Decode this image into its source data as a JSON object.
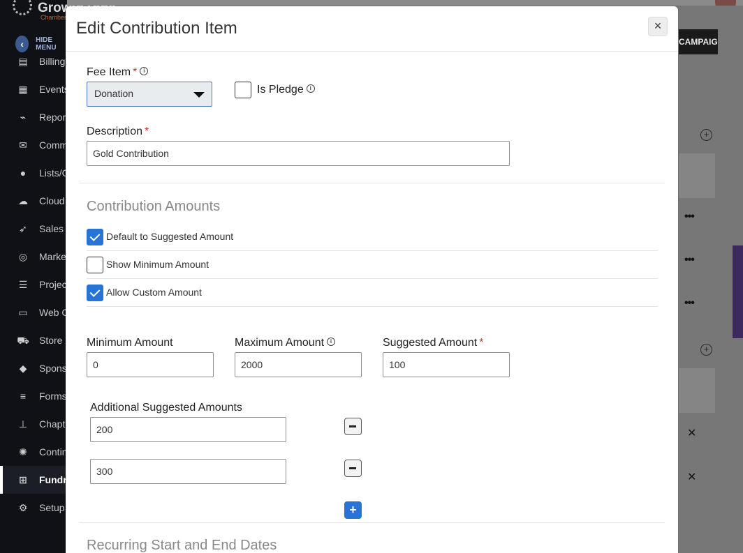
{
  "app": {
    "logo_text": "GrowthZone",
    "logo_sub": "Chamber",
    "hide_menu_label": "HIDE MENU",
    "nav_items": [
      {
        "label": "Billing",
        "icon": "billing-icon"
      },
      {
        "label": "Events",
        "icon": "calendar-icon"
      },
      {
        "label": "Reports",
        "icon": "chart-icon"
      },
      {
        "label": "Communication",
        "icon": "envelope-icon"
      },
      {
        "label": "Lists/Groups",
        "icon": "users-icon"
      },
      {
        "label": "Cloud",
        "icon": "cloud-icon"
      },
      {
        "label": "Sales",
        "icon": "rocket-icon"
      },
      {
        "label": "Marketing",
        "icon": "target-icon"
      },
      {
        "label": "Projects",
        "icon": "checklist-icon"
      },
      {
        "label": "Web Content",
        "icon": "web-icon"
      },
      {
        "label": "Store",
        "icon": "cart-icon"
      },
      {
        "label": "Sponsorships",
        "icon": "diamond-icon"
      },
      {
        "label": "Forms",
        "icon": "list-icon"
      },
      {
        "label": "Chapters",
        "icon": "sitemap-icon"
      },
      {
        "label": "Continuing Ed",
        "icon": "badge-icon"
      },
      {
        "label": "Fundraising",
        "icon": "gift-icon",
        "active": true
      },
      {
        "label": "Setup",
        "icon": "gear-icon"
      }
    ],
    "campaign_button": "CAMPAIGN"
  },
  "modal": {
    "title": "Edit Contribution Item",
    "close_glyph": "×",
    "fee_item": {
      "label": "Fee Item",
      "required_mark": "*",
      "selected": "Donation"
    },
    "is_pledge": {
      "label": "Is Pledge",
      "checked": false
    },
    "description": {
      "label": "Description",
      "required_mark": "*",
      "value": "Gold Contribution"
    },
    "contribution_amounts": {
      "title": "Contribution Amounts",
      "options": [
        {
          "label": "Default to Suggested Amount",
          "checked": true
        },
        {
          "label": "Show Minimum Amount",
          "checked": false
        },
        {
          "label": "Allow Custom Amount",
          "checked": true
        }
      ]
    },
    "amounts": {
      "minimum": {
        "label": "Minimum Amount",
        "value": "0"
      },
      "maximum": {
        "label": "Maximum Amount",
        "value": "2000"
      },
      "suggested": {
        "label": "Suggested Amount",
        "required_mark": "*",
        "value": "100"
      }
    },
    "additional": {
      "label": "Additional Suggested Amounts",
      "values": [
        "200",
        "300"
      ],
      "add_glyph": "+"
    },
    "recurring": {
      "title": "Recurring Start and End Dates"
    }
  },
  "colors": {
    "primary": "#2873d6",
    "required": "#c0392b",
    "overlay": "#6f6f6f"
  }
}
